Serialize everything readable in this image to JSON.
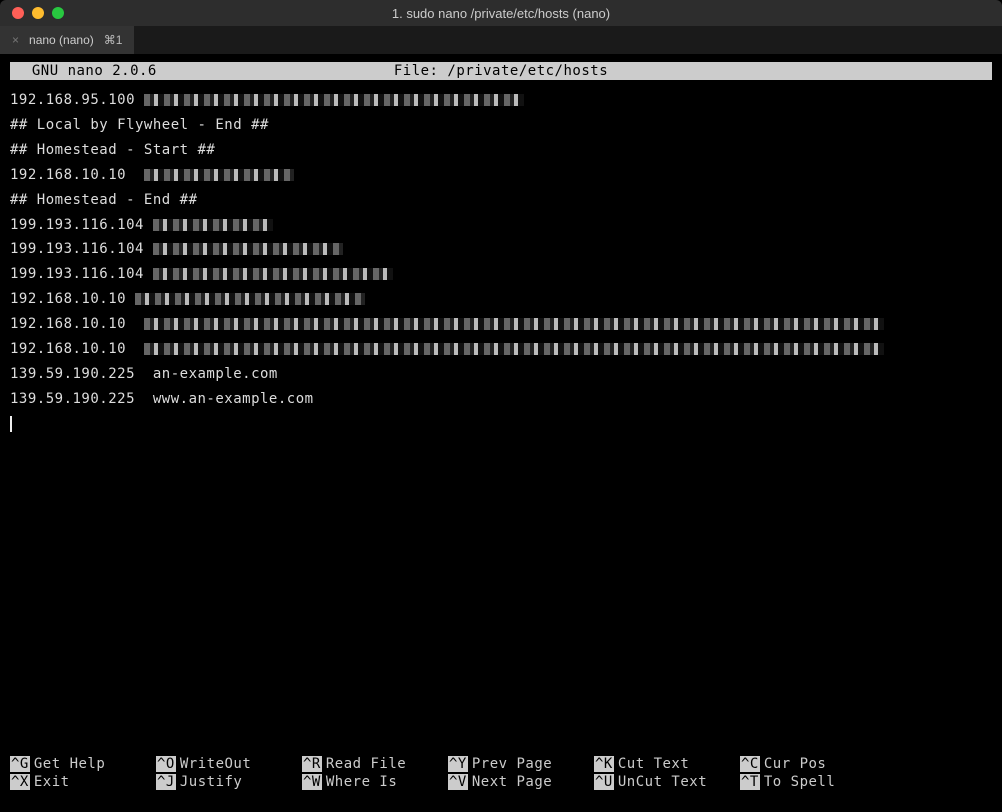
{
  "window": {
    "title": "1. sudo nano /private/etc/hosts (nano)"
  },
  "tab": {
    "label": "nano (nano)",
    "shortcut": "⌘1",
    "close": "×"
  },
  "nano": {
    "app": "  GNU nano 2.0.6",
    "file_label": "File: /private/etc/hosts"
  },
  "content": {
    "lines": [
      {
        "text": "192.168.95.100 ",
        "redacted": 380
      },
      {
        "text": "## Local by Flywheel - End ##"
      },
      {
        "text": ""
      },
      {
        "text": "## Homestead - Start ##"
      },
      {
        "text": "192.168.10.10  ",
        "redacted": 150
      },
      {
        "text": ""
      },
      {
        "text": "## Homestead - End ##"
      },
      {
        "text": ""
      },
      {
        "text": "199.193.116.104 ",
        "redacted": 120
      },
      {
        "text": "199.193.116.104 ",
        "redacted": 190
      },
      {
        "text": "199.193.116.104 ",
        "redacted": 240
      },
      {
        "text": "192.168.10.10 ",
        "redacted": 230
      },
      {
        "text": "192.168.10.10  ",
        "redacted": 740
      },
      {
        "text": "192.168.10.10  ",
        "redacted": 740
      },
      {
        "text": ""
      },
      {
        "text": "139.59.190.225  an-example.com"
      },
      {
        "text": "139.59.190.225  www.an-example.com"
      }
    ]
  },
  "menu": {
    "row1": [
      {
        "key": "^G",
        "label": "Get Help"
      },
      {
        "key": "^O",
        "label": "WriteOut"
      },
      {
        "key": "^R",
        "label": "Read File"
      },
      {
        "key": "^Y",
        "label": "Prev Page"
      },
      {
        "key": "^K",
        "label": "Cut Text"
      },
      {
        "key": "^C",
        "label": "Cur Pos"
      }
    ],
    "row2": [
      {
        "key": "^X",
        "label": "Exit"
      },
      {
        "key": "^J",
        "label": "Justify"
      },
      {
        "key": "^W",
        "label": "Where Is"
      },
      {
        "key": "^V",
        "label": "Next Page"
      },
      {
        "key": "^U",
        "label": "UnCut Text"
      },
      {
        "key": "^T",
        "label": "To Spell"
      }
    ]
  }
}
